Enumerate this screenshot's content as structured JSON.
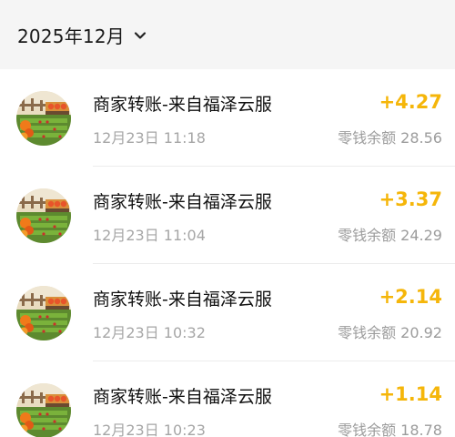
{
  "header": {
    "month": "2025年12月",
    "chevron_icon": "chevron-down-icon"
  },
  "transactions": [
    {
      "title": "商家转账-来自福泽云服",
      "time": "12月23日 11:18",
      "amount": "+4.27",
      "balance": "零钱余额 28.56"
    },
    {
      "title": "商家转账-来自福泽云服",
      "time": "12月23日 11:04",
      "amount": "+3.37",
      "balance": "零钱余额 24.29"
    },
    {
      "title": "商家转账-来自福泽云服",
      "time": "12月23日 10:32",
      "amount": "+2.14",
      "balance": "零钱余额 20.92"
    },
    {
      "title": "商家转账-来自福泽云服",
      "time": "12月23日 10:23",
      "amount": "+1.14",
      "balance": "零钱余额 18.78"
    }
  ],
  "colors": {
    "amount": "#f5b60a",
    "header_bg": "#f5f5f5",
    "secondary_text": "#a6a6a6"
  }
}
